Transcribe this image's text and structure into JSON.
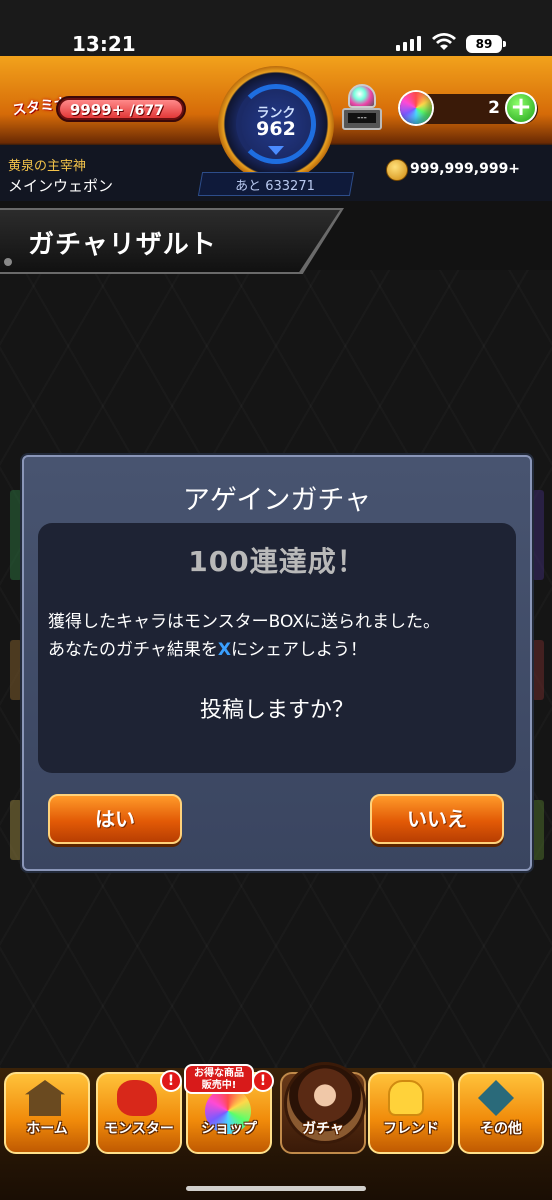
{
  "status_bar": {
    "time": "13:21",
    "battery": "89"
  },
  "header": {
    "stamina_label": "スタミナ",
    "stamina_current": "9999+",
    "stamina_max": "/677",
    "rank_label": "ランク",
    "rank_value": "962",
    "exp_remaining": "あと 633271",
    "orb_machine_display": "---",
    "orb_count": "2",
    "player_title": "黄泉の主宰神",
    "player_weapon": "メインウェポン",
    "coin_value": "999,999,999+"
  },
  "banner": {
    "title": "ガチャリザルト"
  },
  "dialog": {
    "title": "アゲインガチャ",
    "headline": "100連達成！",
    "message_line1": "獲得したキャラはモンスターBOXに送られました。",
    "message_line2_pre": "あなたのガチャ結果を",
    "message_line2_x": "X",
    "message_line2_post": "にシェアしよう！",
    "question": "投稿しますか？",
    "yes_label": "はい",
    "no_label": "いいえ"
  },
  "bottom_nav": {
    "items": [
      {
        "label": "ホーム",
        "icon": "home-icon"
      },
      {
        "label": "モンスター",
        "icon": "monster-icon"
      },
      {
        "label": "ショップ",
        "icon": "shop-icon"
      },
      {
        "label": "ガチャ",
        "icon": "gacha-character-icon"
      },
      {
        "label": "フレンド",
        "icon": "friend-icon"
      },
      {
        "label": "その他",
        "icon": "other-icon"
      }
    ],
    "alert_mark": "!",
    "shop_badge_line1": "お得な商品",
    "shop_badge_line2": "販売中!"
  },
  "colors": {
    "accent_orange": "#e25a06",
    "dialog_bg": "#3a4560",
    "x_blue": "#3aa0ff"
  }
}
